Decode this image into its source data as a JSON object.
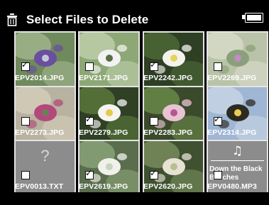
{
  "header": {
    "title": "Select Files to Delete",
    "icon": "trash-icon",
    "battery_icon": "battery-icon"
  },
  "files": [
    {
      "name": "EPV2014.JPG",
      "checked": true,
      "kind": "photo",
      "theme": "flower-purple"
    },
    {
      "name": "EPV2171.JPG",
      "checked": false,
      "kind": "photo",
      "theme": "lily-of-valley"
    },
    {
      "name": "EPV2242.JPG",
      "checked": true,
      "kind": "photo",
      "theme": "white-flower"
    },
    {
      "name": "EPV2269.JPG",
      "checked": false,
      "kind": "photo",
      "theme": "blur-meadow"
    },
    {
      "name": "EPV2273.JPG",
      "checked": false,
      "kind": "photo",
      "theme": "orchid"
    },
    {
      "name": "EPV2279.JPG",
      "checked": true,
      "kind": "photo",
      "theme": "daisy"
    },
    {
      "name": "EPV2283.JPG",
      "checked": false,
      "kind": "photo",
      "theme": "dark-bloom"
    },
    {
      "name": "EPV2314.JPG",
      "checked": true,
      "kind": "photo",
      "theme": "sunflower"
    },
    {
      "name": "EPV0013.TXT",
      "checked": false,
      "kind": "unknown",
      "symbol": "?"
    },
    {
      "name": "EPV2619.JPG",
      "checked": true,
      "kind": "photo",
      "theme": "white-cluster"
    },
    {
      "name": "EPV2620.JPG",
      "checked": true,
      "kind": "photo",
      "theme": "garden"
    },
    {
      "name": "EPV0480.MP3",
      "checked": false,
      "kind": "audio",
      "symbol": "♫",
      "track_title": "Down the Black Beaches"
    }
  ]
}
